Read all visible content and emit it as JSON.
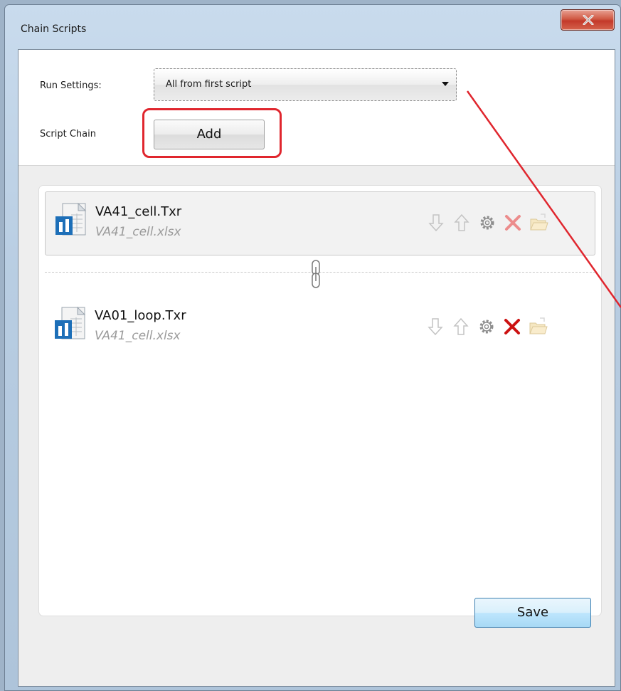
{
  "window": {
    "title": "Chain Scripts"
  },
  "settings": {
    "run_settings_label": "Run Settings:",
    "run_settings_value": "All from first script",
    "script_chain_label": "Script Chain",
    "add_label": "Add"
  },
  "scripts": [
    {
      "name": "VA41_cell.Txr",
      "data_file": "VA41_cell.xlsx",
      "selected": true
    },
    {
      "name": "VA01_loop.Txr",
      "data_file": "VA41_cell.xlsx",
      "selected": false
    }
  ],
  "footer": {
    "save_label": "Save"
  },
  "colors": {
    "annotation": "#e0262e",
    "delete": "#cc1111",
    "title_accent": "#b8cde2"
  },
  "icons": [
    "close-icon",
    "dropdown-arrow-icon",
    "script-file-icon",
    "move-down-icon",
    "move-up-icon",
    "settings-icon",
    "delete-icon",
    "open-folder-icon",
    "chain-link-icon"
  ]
}
